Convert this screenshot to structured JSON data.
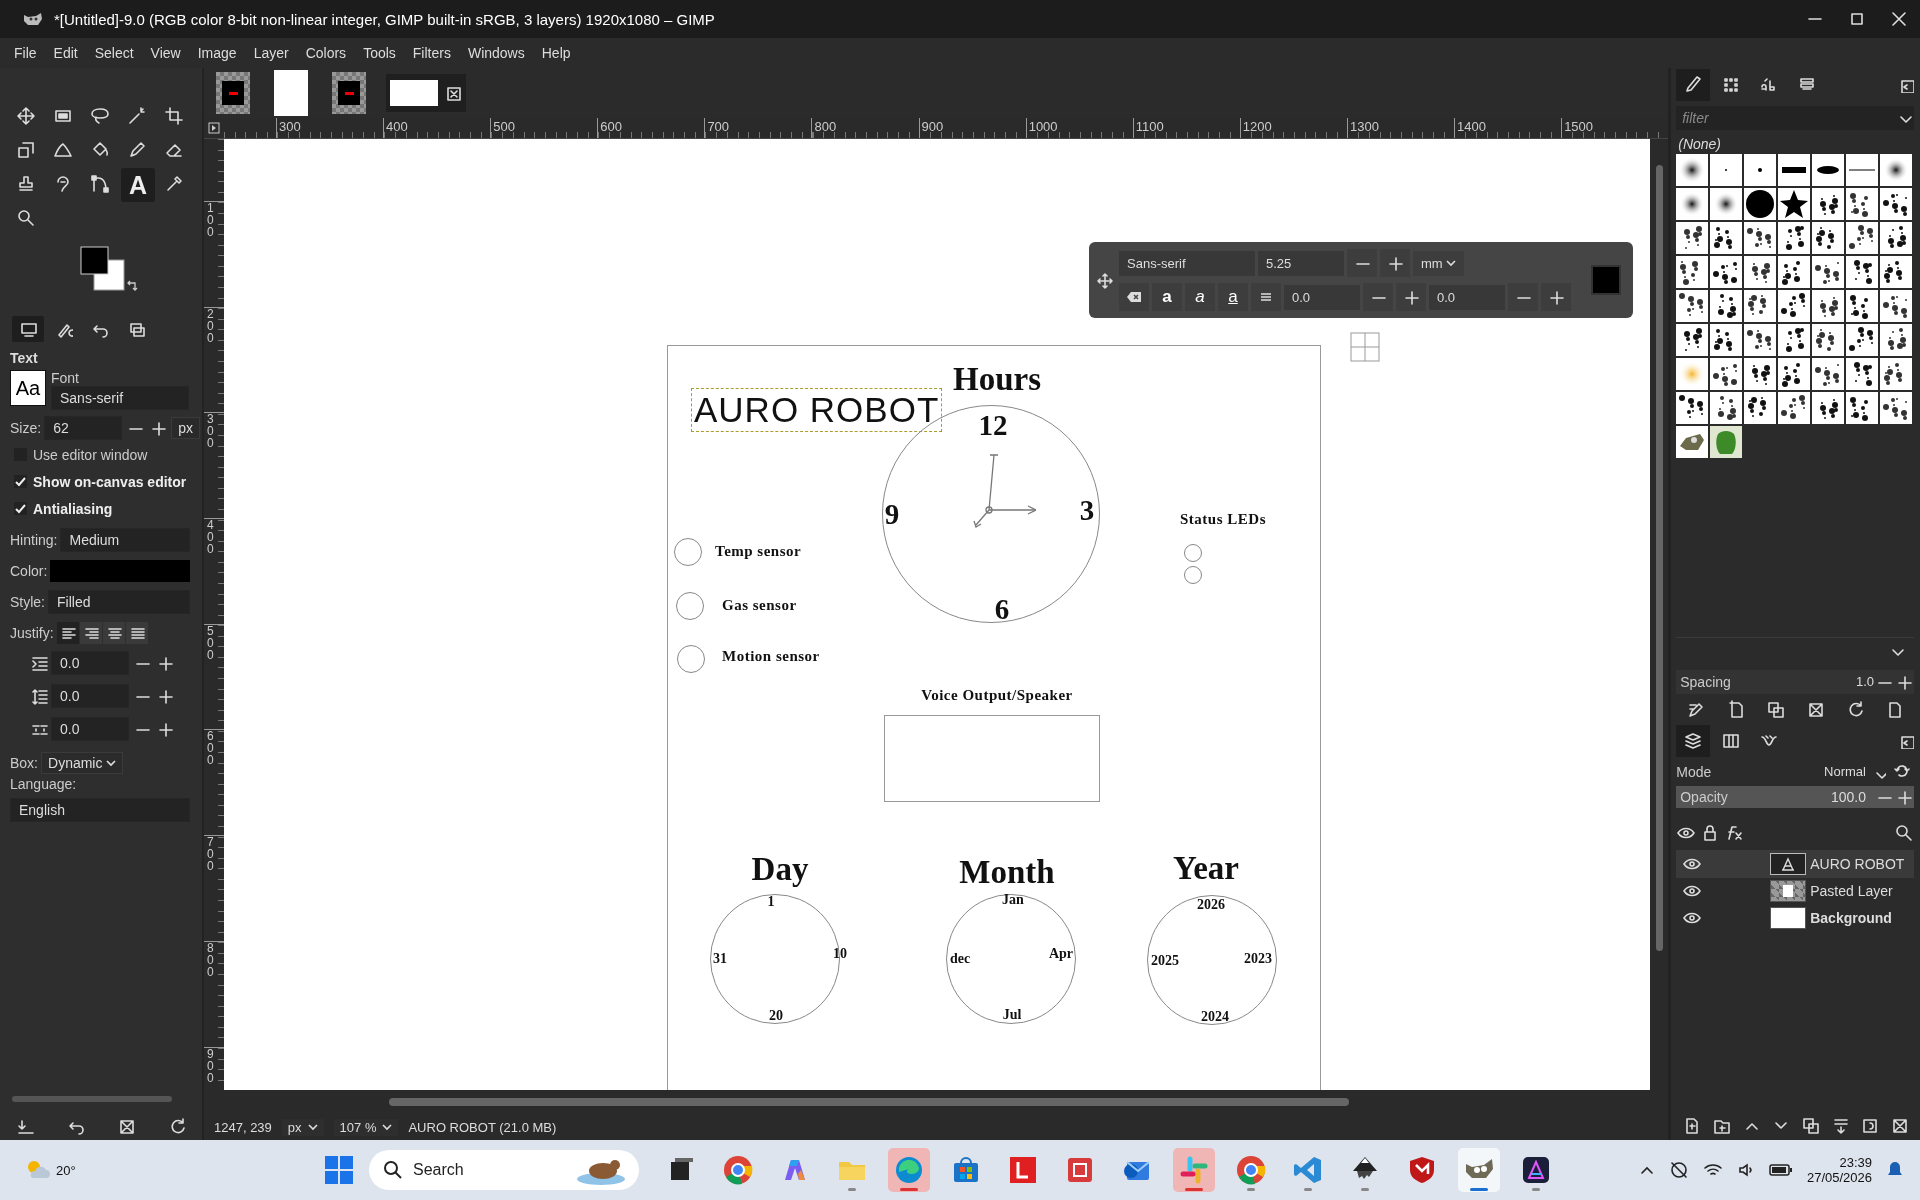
{
  "window": {
    "title": "*[Untitled]-9.0 (RGB color 8-bit non-linear integer, GIMP built-in sRGB, 3 layers) 1920x1080 – GIMP"
  },
  "menu": [
    "File",
    "Edit",
    "Select",
    "View",
    "Image",
    "Layer",
    "Colors",
    "Tools",
    "Filters",
    "Windows",
    "Help"
  ],
  "image_tabs": [
    {
      "kind": "layered",
      "selected": false
    },
    {
      "kind": "blank",
      "selected": false
    },
    {
      "kind": "layered",
      "selected": false
    },
    {
      "kind": "wide",
      "selected": true
    }
  ],
  "tools": [
    {
      "kind": "move",
      "selected": false
    },
    {
      "kind": "rect-select",
      "selected": false
    },
    {
      "kind": "lasso",
      "selected": false
    },
    {
      "kind": "wand",
      "selected": false
    },
    {
      "kind": "crop",
      "selected": false
    },
    {
      "kind": "transform",
      "selected": false
    },
    {
      "kind": "warp",
      "selected": false
    },
    {
      "kind": "bucket",
      "selected": false
    },
    {
      "kind": "pencil",
      "selected": false
    },
    {
      "kind": "eraser",
      "selected": false
    },
    {
      "kind": "stamp",
      "selected": false
    },
    {
      "kind": "smudge",
      "selected": false
    },
    {
      "kind": "paths",
      "selected": false
    },
    {
      "kind": "text",
      "glyph": "A",
      "selected": true
    },
    {
      "kind": "picker",
      "selected": false
    },
    {
      "kind": "zoom",
      "selected": false
    }
  ],
  "tool_options": {
    "tabs": [
      {
        "kind": "options",
        "selected": true
      },
      {
        "kind": "info",
        "selected": false
      },
      {
        "kind": "undo",
        "selected": false
      },
      {
        "kind": "images",
        "selected": false
      }
    ],
    "title": "Text",
    "preview": "Aa",
    "font_label": "Font",
    "font": "Sans-serif",
    "size_label": "Size:",
    "size": "62",
    "unit": "px",
    "checks": [
      {
        "label": "Use editor window",
        "checked": false
      },
      {
        "label": "Show on-canvas editor",
        "checked": true
      },
      {
        "label": "Antialiasing",
        "checked": true
      }
    ],
    "hinting_label": "Hinting:",
    "hinting": "Medium",
    "color_label": "Color:",
    "style_label": "Style:",
    "style": "Filled",
    "justify_label": "Justify:",
    "justify": [
      {
        "kind": "left",
        "selected": true
      },
      {
        "kind": "right",
        "selected": false
      },
      {
        "kind": "center",
        "selected": false
      },
      {
        "kind": "fill",
        "selected": false
      }
    ],
    "spacings": [
      {
        "kind": "indent",
        "value": "0.0"
      },
      {
        "kind": "line",
        "value": "0.0"
      },
      {
        "kind": "letter",
        "value": "0.0"
      }
    ],
    "box_label": "Box:",
    "box": "Dynamic",
    "language_label": "Language:",
    "language": "English"
  },
  "rulers": {
    "horizontal": [
      "300",
      "400",
      "500",
      "600",
      "700",
      "800",
      "900",
      "1000",
      "1100",
      "1200",
      "1300",
      "1400",
      "1500"
    ],
    "vertical": [
      "100",
      "200",
      "300",
      "400",
      "500",
      "600",
      "700",
      "800",
      "900"
    ]
  },
  "canvas": {
    "title": "AURO ROBOT",
    "hours": {
      "title": "Hours",
      "marks": [
        "12",
        "3",
        "6",
        "9"
      ]
    },
    "sensors": [
      {
        "label": "Temp sensor"
      },
      {
        "label": "Gas sensor"
      },
      {
        "label": "Motion sensor"
      }
    ],
    "status_leds": {
      "title": "Status LEDs"
    },
    "speaker": {
      "title": "Voice Output/Speaker"
    },
    "dials": [
      {
        "title": "Day",
        "marks": [
          "1",
          "10",
          "20",
          "31"
        ]
      },
      {
        "title": "Month",
        "marks": [
          "Jan",
          "Apr",
          "Jul",
          "dec"
        ]
      },
      {
        "title": "Year",
        "marks": [
          "2026",
          "2023",
          "2024",
          "2025"
        ]
      }
    ]
  },
  "text_toolbar": {
    "font": "Sans-serif",
    "size": "5.25",
    "unit": "mm",
    "formats": [
      {
        "kind": "clear"
      },
      {
        "kind": "bold",
        "glyph": "a"
      },
      {
        "kind": "italic",
        "glyph": "a"
      },
      {
        "kind": "underline",
        "glyph": "a"
      },
      {
        "kind": "strike"
      }
    ],
    "baseline": "0.0",
    "kerning": "0.0"
  },
  "status_bar": {
    "pointer": "1247, 239",
    "unit": "px",
    "zoom": "107 %",
    "message": "AURO ROBOT (21.0 MB)"
  },
  "brushes": {
    "tabs": [
      {
        "kind": "brush",
        "selected": true
      },
      {
        "kind": "pattern",
        "selected": false
      },
      {
        "kind": "font",
        "selected": false
      },
      {
        "kind": "document",
        "selected": false
      }
    ],
    "filter_placeholder": "filter",
    "current": "(None)",
    "spacing_label": "Spacing",
    "spacing": "1.0",
    "level": 0.0
  },
  "layers": {
    "tabs": [
      {
        "kind": "layers",
        "selected": true
      },
      {
        "kind": "channels",
        "selected": false
      },
      {
        "kind": "paths",
        "selected": false
      }
    ],
    "mode_label": "Mode",
    "mode": "Normal",
    "opacity_label": "Opacity",
    "opacity": "100.0",
    "level": 1.0,
    "items": [
      {
        "name": "AURO ROBOT",
        "kind": "text",
        "visible": true,
        "selected": true
      },
      {
        "name": "Pasted Layer",
        "kind": "pasted",
        "visible": true,
        "selected": false
      },
      {
        "name": "Background",
        "kind": "background",
        "visible": true,
        "selected": false
      }
    ]
  },
  "taskbar": {
    "weather": "20°",
    "search_placeholder": "Search",
    "apps": [
      {
        "kind": "taskview",
        "running": false,
        "attention": false,
        "selected": false
      },
      {
        "kind": "chrome",
        "running": false,
        "attention": false,
        "selected": false
      },
      {
        "kind": "copilot",
        "running": false,
        "attention": false,
        "selected": false
      },
      {
        "kind": "folder",
        "running": true,
        "attention": false,
        "selected": false
      },
      {
        "kind": "edge",
        "running": true,
        "attention": true,
        "selected": false
      },
      {
        "kind": "store",
        "running": false,
        "attention": false,
        "selected": false
      },
      {
        "kind": "red-l",
        "running": false,
        "attention": false,
        "selected": false
      },
      {
        "kind": "office",
        "running": false,
        "attention": false,
        "selected": false
      },
      {
        "kind": "mail",
        "running": false,
        "attention": false,
        "selected": false
      },
      {
        "kind": "slack",
        "running": true,
        "attention": true,
        "selected": false
      },
      {
        "kind": "chrome",
        "running": true,
        "attention": false,
        "selected": false
      },
      {
        "kind": "code",
        "running": true,
        "attention": false,
        "selected": false
      },
      {
        "kind": "inkscape",
        "running": true,
        "attention": false,
        "selected": false
      },
      {
        "kind": "shield",
        "running": false,
        "attention": false,
        "selected": false
      },
      {
        "kind": "gimp",
        "running": true,
        "attention": false,
        "selected": true
      },
      {
        "kind": "affinity",
        "running": true,
        "attention": false,
        "selected": false
      }
    ],
    "time": "23:39",
    "date": "27/05/2026"
  }
}
